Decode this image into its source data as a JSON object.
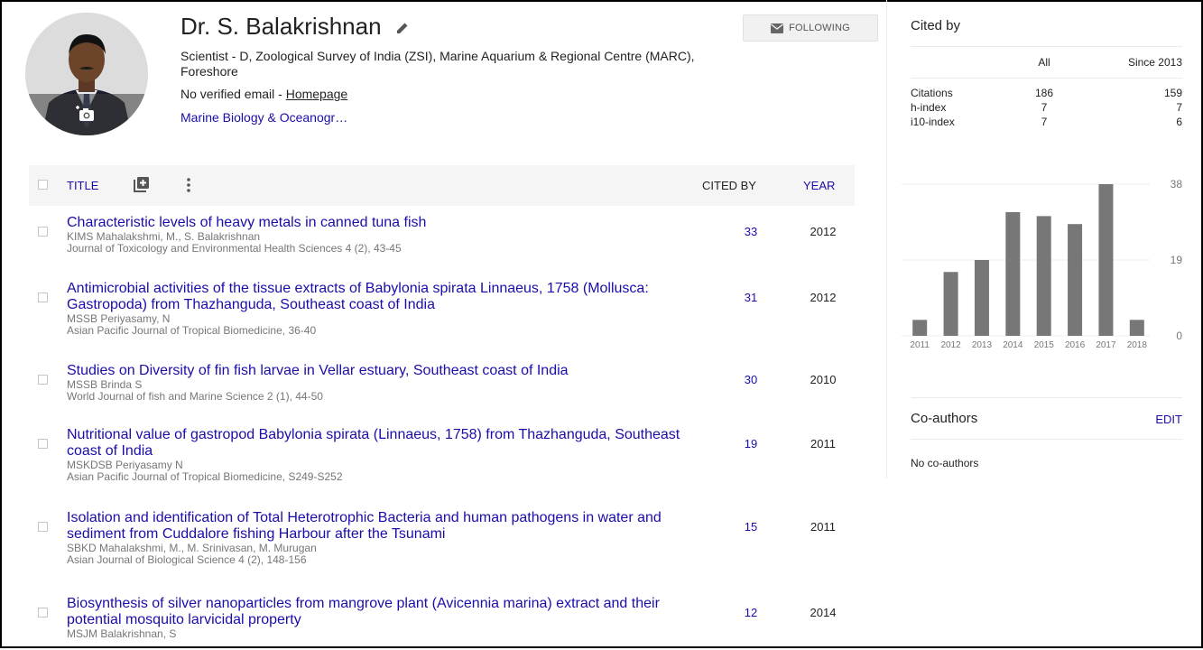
{
  "profile": {
    "name": "Dr. S. Balakrishnan",
    "affiliation": "Scientist - D, Zoological Survey of India (ZSI), Marine Aquarium & Regional Centre (MARC), Foreshore",
    "email_prefix": "No verified email - ",
    "homepage_label": "Homepage",
    "interest": "Marine Biology & Oceanogr…",
    "follow_label": "FOLLOWING"
  },
  "table": {
    "header": {
      "title": "TITLE",
      "cited_by": "CITED BY",
      "year": "YEAR"
    },
    "articles": [
      {
        "title": "Characteristic levels of heavy metals in canned tuna fish",
        "authors": "KIMS Mahalakshmi, M., S. Balakrishnan",
        "venue": "Journal of Toxicology and Environmental Health Sciences 4 (2), 43-45",
        "cited_by": "33",
        "year": "2012"
      },
      {
        "title": "Antimicrobial activities of the tissue extracts of Babylonia spirata Linnaeus, 1758 (Mollusca: Gastropoda) from Thazhanguda, Southeast coast of India",
        "authors": "MSSB Periyasamy, N",
        "venue": "Asian Pacific Journal of Tropical Biomedicine, 36-40",
        "cited_by": "31",
        "year": "2012"
      },
      {
        "title": "Studies on Diversity of fin fish larvae in Vellar estuary, Southeast coast of India",
        "authors": "MSSB Brinda S",
        "venue": "World Journal of fish and Marine Science 2 (1), 44-50",
        "cited_by": "30",
        "year": "2010"
      },
      {
        "title": "Nutritional value of gastropod Babylonia spirata (Linnaeus, 1758) from Thazhanguda, Southeast coast of India",
        "authors": "MSKDSB Periyasamy N",
        "venue": "Asian Pacific Journal of Tropical Biomedicine, S249-S252",
        "cited_by": "19",
        "year": "2011"
      },
      {
        "title": "Isolation and identification of Total Heterotrophic Bacteria and human pathogens in water and sediment from Cuddalore fishing Harbour after the Tsunami",
        "authors": "SBKD Mahalakshmi, M., M. Srinivasan, M. Murugan",
        "venue": "Asian Journal of Biological Science 4 (2), 148-156",
        "cited_by": "15",
        "year": "2011"
      },
      {
        "title": "Biosynthesis of silver nanoparticles from mangrove plant (Avicennia marina) extract and their potential mosquito larvicidal property",
        "authors": "MSJM Balakrishnan, S",
        "venue": "",
        "cited_by": "12",
        "year": "2014"
      }
    ]
  },
  "cited_by": {
    "heading": "Cited by",
    "col_all": "All",
    "col_since": "Since 2013",
    "rows": [
      {
        "label": "Citations",
        "all": "186",
        "since": "159"
      },
      {
        "label": "h-index",
        "all": "7",
        "since": "7"
      },
      {
        "label": "i10-index",
        "all": "7",
        "since": "6"
      }
    ]
  },
  "chart_data": {
    "type": "bar",
    "categories": [
      "2011",
      "2012",
      "2013",
      "2014",
      "2015",
      "2016",
      "2017",
      "2018"
    ],
    "values": [
      4,
      16,
      19,
      31,
      30,
      28,
      38,
      4
    ],
    "y_ticks": [
      0,
      19,
      38
    ],
    "ylim": [
      0,
      38
    ],
    "bar_color": "#777777",
    "title": "",
    "xlabel": "",
    "ylabel": ""
  },
  "coauthors": {
    "heading": "Co-authors",
    "edit_label": "EDIT",
    "empty_text": "No co-authors"
  },
  "colors": {
    "link": "#1a0dab",
    "header_bg": "#f5f5f5",
    "muted_text": "#777777"
  }
}
